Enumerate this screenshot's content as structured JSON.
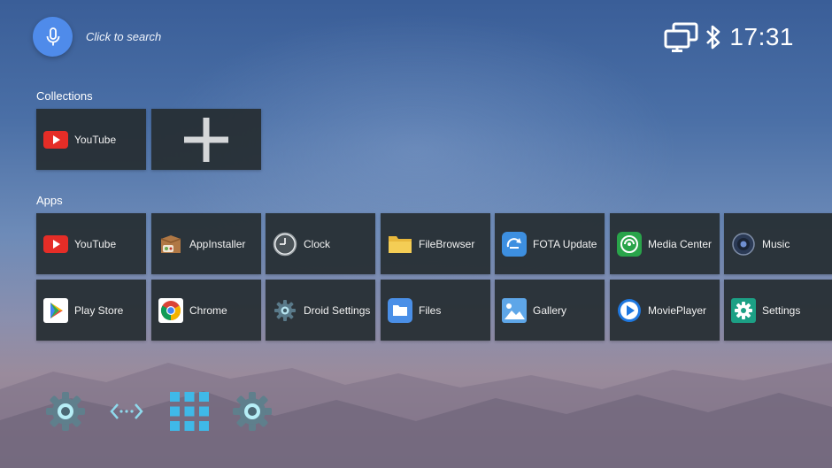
{
  "search": {
    "hint": "Click to search"
  },
  "status": {
    "time": "17:31",
    "icons": [
      "network-icon",
      "bluetooth-icon"
    ]
  },
  "collections": {
    "title": "Collections",
    "items": [
      {
        "label": "YouTube",
        "icon": "youtube-icon"
      }
    ],
    "add_icon": "plus-icon"
  },
  "apps": {
    "title": "Apps",
    "row1": [
      {
        "label": "YouTube",
        "icon": "youtube-icon"
      },
      {
        "label": "AppInstaller",
        "icon": "appinstaller-icon"
      },
      {
        "label": "Clock",
        "icon": "clock-icon"
      },
      {
        "label": "FileBrowser",
        "icon": "folder-icon"
      },
      {
        "label": "FOTA Update",
        "icon": "fota-update-icon"
      },
      {
        "label": "Media Center",
        "icon": "media-center-icon"
      },
      {
        "label": "Music",
        "icon": "music-icon"
      }
    ],
    "row2": [
      {
        "label": "Play Store",
        "icon": "play-store-icon"
      },
      {
        "label": "Chrome",
        "icon": "chrome-icon"
      },
      {
        "label": "Droid Settings",
        "icon": "droid-settings-icon"
      },
      {
        "label": "Files",
        "icon": "files-icon"
      },
      {
        "label": "Gallery",
        "icon": "gallery-icon"
      },
      {
        "label": "MoviePlayer",
        "icon": "movieplayer-icon"
      },
      {
        "label": "Settings",
        "icon": "settings-icon"
      }
    ]
  },
  "dock": {
    "items": [
      "settings-gear-icon",
      "network-arrows-icon",
      "all-apps-grid-icon",
      "settings-gear-icon"
    ]
  },
  "colors": {
    "accent": "#4f8bea",
    "tile_bg": "#262d32",
    "dock_cyan": "#3fb9e8"
  }
}
